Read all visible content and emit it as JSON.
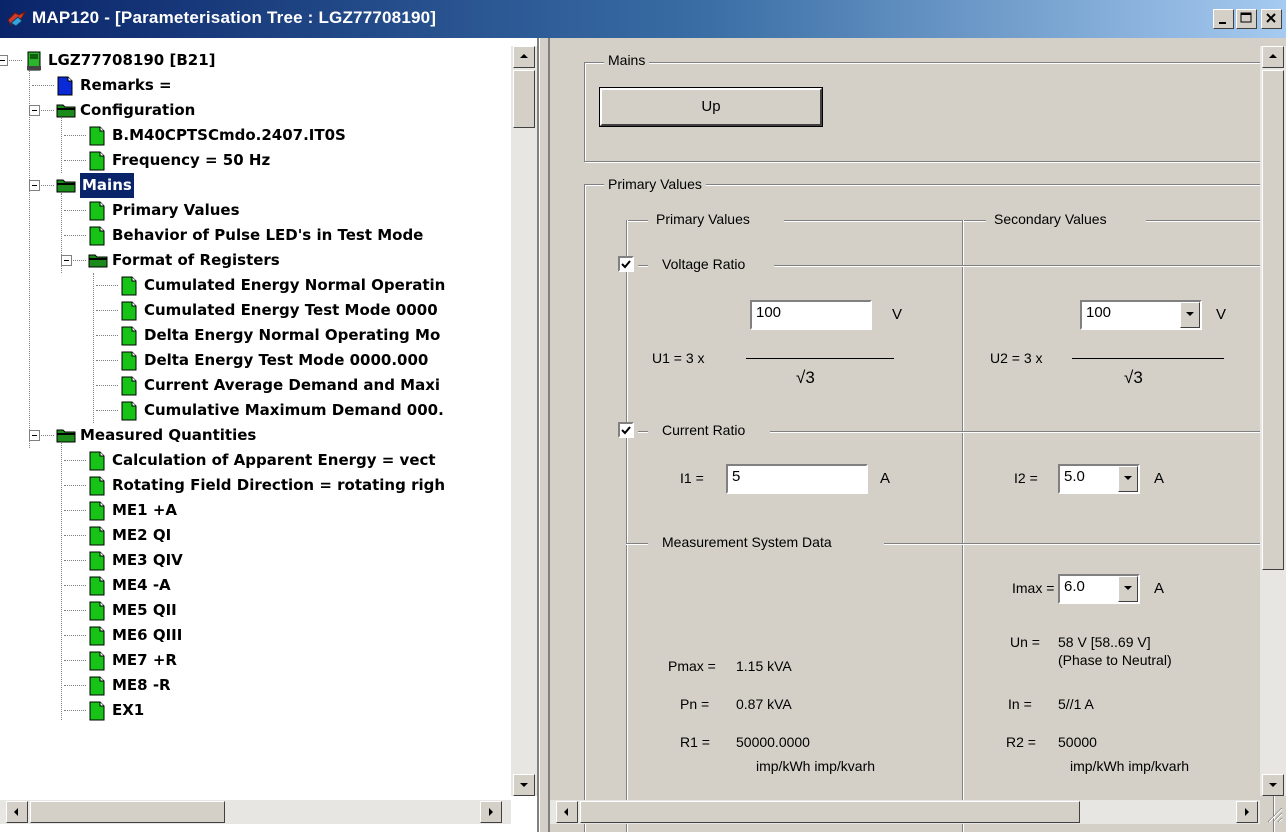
{
  "window": {
    "title": "MAP120 - [Parameterisation Tree : LGZ77708190]",
    "minimize_glyph": "minimize-icon",
    "maximize_glyph": "maximize-icon",
    "close_glyph": "close-icon"
  },
  "tree": {
    "items": [
      {
        "label": "LGZ77708190 [B21]",
        "icon": "meter-icon"
      },
      {
        "label": "Remarks =",
        "icon": "blue-doc-icon"
      },
      {
        "label": "Configuration",
        "icon": "folder-icon"
      },
      {
        "label": "B.M40CPTSCmdo.2407.IT0S",
        "icon": "green-doc-icon"
      },
      {
        "label": "Frequency = 50 Hz",
        "icon": "green-doc-icon"
      },
      {
        "label": "Mains",
        "icon": "folder-icon"
      },
      {
        "label": "Primary Values",
        "icon": "green-doc-icon"
      },
      {
        "label": "Behavior of Pulse LED's in Test Mode",
        "icon": "green-doc-icon"
      },
      {
        "label": "Format of Registers",
        "icon": "folder-icon"
      },
      {
        "label": "Cumulated Energy Normal Operatin",
        "icon": "green-doc-icon"
      },
      {
        "label": "Cumulated Energy Test Mode 0000",
        "icon": "green-doc-icon"
      },
      {
        "label": "Delta Energy Normal Operating Mo",
        "icon": "green-doc-icon"
      },
      {
        "label": "Delta Energy Test Mode 0000.000",
        "icon": "green-doc-icon"
      },
      {
        "label": "Current Average Demand and Maxi",
        "icon": "green-doc-icon"
      },
      {
        "label": "Cumulative Maximum Demand 000.",
        "icon": "green-doc-icon"
      },
      {
        "label": "Measured Quantities",
        "icon": "folder-icon"
      },
      {
        "label": "Calculation of Apparent Energy = vect",
        "icon": "green-doc-icon"
      },
      {
        "label": "Rotating Field Direction = rotating righ",
        "icon": "green-doc-icon"
      },
      {
        "label": "ME1 +A",
        "icon": "green-doc-icon"
      },
      {
        "label": "ME2 QI",
        "icon": "green-doc-icon"
      },
      {
        "label": "ME3 QIV",
        "icon": "green-doc-icon"
      },
      {
        "label": "ME4 -A",
        "icon": "green-doc-icon"
      },
      {
        "label": "ME5 QII",
        "icon": "green-doc-icon"
      },
      {
        "label": "ME6 QIII",
        "icon": "green-doc-icon"
      },
      {
        "label": "ME7 +R",
        "icon": "green-doc-icon"
      },
      {
        "label": "ME8 -R",
        "icon": "green-doc-icon"
      },
      {
        "label": "EX1",
        "icon": "green-doc-icon"
      }
    ]
  },
  "mains": {
    "legend": "Mains",
    "up_button": "Up"
  },
  "primary_values": {
    "legend": "Primary Values",
    "primary_col_legend": "Primary Values",
    "secondary_col_legend": "Secondary Values",
    "voltage_ratio": {
      "label": "Voltage Ratio",
      "checked": true,
      "u1_prefix": "U1 = 3 x",
      "u1_value": "100",
      "u1_unit": "V",
      "u1_denominator": "√3",
      "u2_prefix": "U2 = 3 x",
      "u2_value": "100",
      "u2_unit": "V",
      "u2_denominator": "√3"
    },
    "current_ratio": {
      "label": "Current Ratio",
      "checked": true,
      "i1_prefix": "I1 =",
      "i1_value": "5",
      "i1_unit": "A",
      "i2_prefix": "I2 =",
      "i2_value": "5.0",
      "i2_unit": "A"
    },
    "measurement_system": {
      "legend": "Measurement System Data",
      "imax_prefix": "Imax =",
      "imax_value": "6.0",
      "imax_unit": "A",
      "un_prefix": "Un =",
      "un_value": "58 V [58..69 V]",
      "un_note": "(Phase to Neutral)",
      "pmax_prefix": "Pmax =",
      "pmax_value": "1.15 kVA",
      "pn_prefix": "Pn =",
      "pn_value": "0.87 kVA",
      "in_prefix": "In =",
      "in_value": "5//1 A",
      "r1_prefix": "R1 =",
      "r1_value": "50000.0000",
      "r1_units": "imp/kWh  imp/kvarh",
      "r2_prefix": "R2 =",
      "r2_value": "50000",
      "r2_units": "imp/kWh  imp/kvarh"
    }
  },
  "colors": {
    "title_start": "#0a246a",
    "title_end": "#a6caf0",
    "selection": "#0a246a",
    "folder": "#1a8a1a",
    "green_doc": "#17c317",
    "blue_doc": "#0a2ad8"
  }
}
